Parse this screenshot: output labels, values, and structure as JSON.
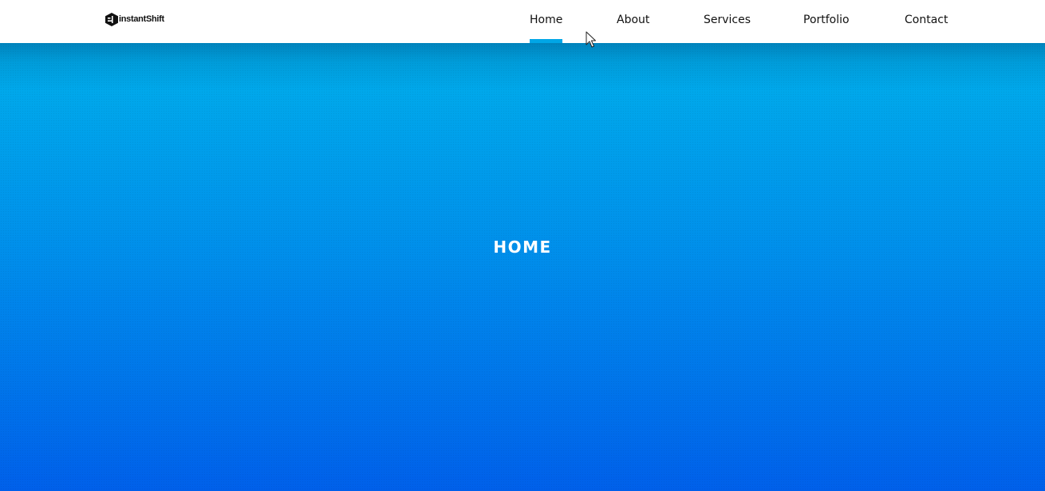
{
  "brand": {
    "name": "instantShift"
  },
  "nav": {
    "items": [
      {
        "label": "Home",
        "active": true
      },
      {
        "label": "About",
        "active": false
      },
      {
        "label": "Services",
        "active": false
      },
      {
        "label": "Portfolio",
        "active": false
      },
      {
        "label": "Contact",
        "active": false
      }
    ]
  },
  "hero": {
    "title": "HOME"
  },
  "colors": {
    "accent": "#00a6e6",
    "hero_top": "#00afeb",
    "hero_bottom": "#0060ea",
    "nav_text": "#111111",
    "hero_text": "#ffffff"
  },
  "icons": {
    "logo": "instantshift-logo-icon",
    "pointer": "mouse-cursor-icon"
  }
}
